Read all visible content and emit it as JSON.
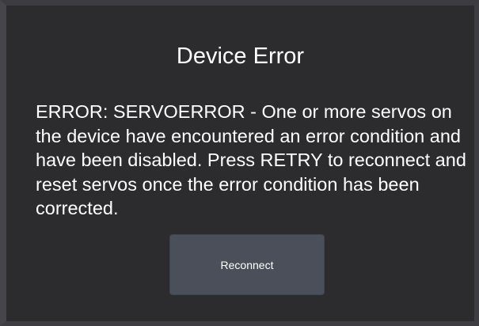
{
  "dialog": {
    "title": "Device Error",
    "message": "ERROR: SERVOERROR - One or more servos on the device have encountered an error condition and have been disabled. Press RETRY to reconnect and reset servos once the error condition has been corrected.",
    "button_label": "Reconnect"
  },
  "colors": {
    "background": "#2c2c2e",
    "border": "#3e3e42",
    "button": "#4a4f59",
    "text": "#ffffff"
  }
}
